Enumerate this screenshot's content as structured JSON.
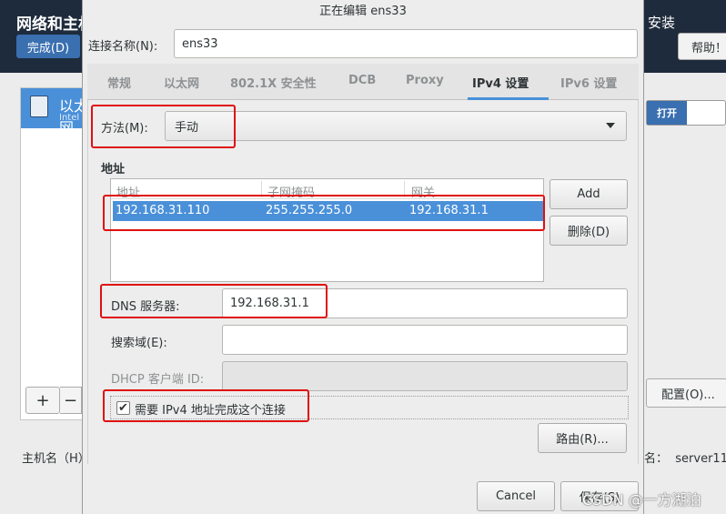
{
  "background": {
    "title": "网络和主机名",
    "done_button": "完成(D)",
    "install_label": "安装",
    "help_button": "帮助！",
    "device_name": "以太网",
    "device_sub": "Intel",
    "add_button": "+",
    "remove_button": "−",
    "hostname_label": "主机名（H）",
    "toggle_on": "打开",
    "config_button": "配置(O)...",
    "current_hostname_label": "名：",
    "current_hostname_value": "server11"
  },
  "dialog": {
    "title": "正在编辑 ens33",
    "conn_name_label": "连接名称(N):",
    "conn_name_value": "ens33",
    "tabs": [
      {
        "label": "常规"
      },
      {
        "label": "以太网"
      },
      {
        "label": "802.1X 安全性"
      },
      {
        "label": "DCB"
      },
      {
        "label": "Proxy"
      },
      {
        "label": "IPv4 设置"
      },
      {
        "label": "IPv6 设置"
      }
    ],
    "active_tab": "IPv4 设置",
    "method_label": "方法(M):",
    "method_value": "手动",
    "address_section_label": "地址",
    "address_columns": [
      "地址",
      "子网掩码",
      "网关"
    ],
    "address_rows": [
      [
        "192.168.31.110",
        "255.255.255.0",
        "192.168.31.1"
      ]
    ],
    "add_button": "Add",
    "delete_button": "删除(D)",
    "dns_label": "DNS 服务器:",
    "dns_value": "192.168.31.1",
    "search_domain_label": "搜索域(E):",
    "search_domain_value": "",
    "dhcp_client_id_label": "DHCP 客户端 ID:",
    "dhcp_client_id_value": "",
    "require_ipv4_label": "需要 IPv4 地址完成这个连接",
    "require_ipv4_checked": true,
    "routes_button": "路由(R)...",
    "cancel_button": "Cancel",
    "save_button": "保存(S)"
  },
  "watermark": "CSDN @一方湖泊",
  "colors": {
    "accent": "#4a90d9",
    "annotation_red": "#e01010",
    "header_dark": "#1e2b3c"
  }
}
